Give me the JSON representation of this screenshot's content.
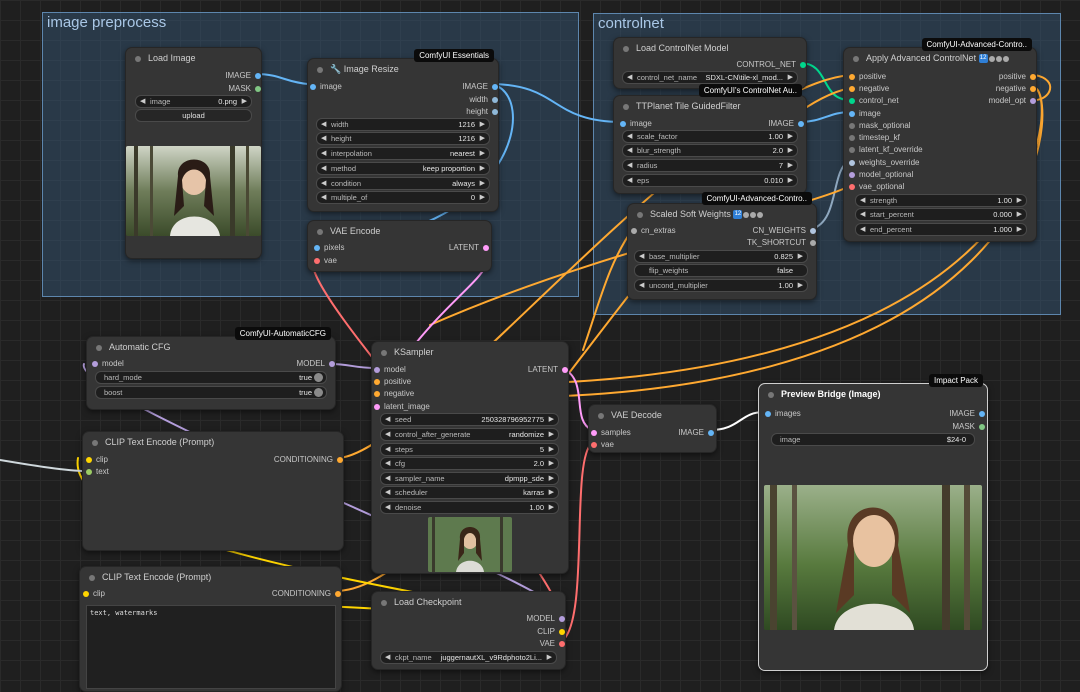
{
  "groups": {
    "image_preprocess": "image preprocess",
    "controlnet": "controlnet"
  },
  "badges": {
    "essentials": "ComfyUI Essentials",
    "advanced_controlnet": "ComfyUI-Advanced-Contro..",
    "controlnet_aux": "ComfyUI's ControlNet Au..",
    "advanced_controlnet_2": "ComfyUI-Advanced-Contro..",
    "automatic_cfg": "ComfyUI-AutomaticCFG",
    "impact_pack": "Impact Pack"
  },
  "load_image": {
    "title": "Load Image",
    "out_image": "IMAGE",
    "out_mask": "MASK",
    "image_label": "image",
    "image_value": "0.png",
    "upload": "upload"
  },
  "image_resize": {
    "title": "Image Resize",
    "in_image": "image",
    "out_image": "IMAGE",
    "out_width": "width",
    "out_height": "height",
    "widgets": [
      {
        "label": "width",
        "value": "1216"
      },
      {
        "label": "height",
        "value": "1216"
      },
      {
        "label": "interpolation",
        "value": "nearest"
      },
      {
        "label": "method",
        "value": "keep proportion"
      },
      {
        "label": "condition",
        "value": "always"
      },
      {
        "label": "multiple_of",
        "value": "0"
      }
    ]
  },
  "vae_encode": {
    "title": "VAE Encode",
    "in_pixels": "pixels",
    "in_vae": "vae",
    "out_latent": "LATENT"
  },
  "load_controlnet": {
    "title": "Load ControlNet Model",
    "out": "CONTROL_NET",
    "name_label": "control_net_name",
    "name_value": "SDXL-CN\\tile-xl_mod..."
  },
  "tile_filter": {
    "title": "TTPlanet Tile GuidedFilter",
    "in_image": "image",
    "out_image": "IMAGE",
    "widgets": [
      {
        "label": "scale_factor",
        "value": "1.00"
      },
      {
        "label": "blur_strength",
        "value": "2.0"
      },
      {
        "label": "radius",
        "value": "7"
      },
      {
        "label": "eps",
        "value": "0.010"
      }
    ]
  },
  "scaled_soft": {
    "title": "Scaled Soft Weights",
    "in_extras": "cn_extras",
    "out_cn": "CN_WEIGHTS",
    "out_tk": "TK_SHORTCUT",
    "widgets": [
      {
        "label": "base_multiplier",
        "value": "0.825"
      },
      {
        "label": "flip_weights",
        "value": "false"
      },
      {
        "label": "uncond_multiplier",
        "value": "1.00"
      }
    ]
  },
  "apply_cn": {
    "title": "Apply Advanced ControlNet",
    "inputs": [
      "positive",
      "negative",
      "control_net",
      "image",
      "mask_optional",
      "timestep_kf",
      "latent_kf_override",
      "weights_override",
      "model_optional",
      "vae_optional"
    ],
    "outputs": [
      "positive",
      "negative",
      "model_opt"
    ],
    "widgets": [
      {
        "label": "strength",
        "value": "1.00"
      },
      {
        "label": "start_percent",
        "value": "0.000"
      },
      {
        "label": "end_percent",
        "value": "1.000"
      }
    ]
  },
  "auto_cfg": {
    "title": "Automatic CFG",
    "in_model": "model",
    "out_model": "MODEL",
    "widgets": [
      {
        "label": "hard_mode",
        "value": "true"
      },
      {
        "label": "boost",
        "value": "true"
      }
    ]
  },
  "clip_pos": {
    "title": "CLIP Text Encode (Prompt)",
    "in_clip": "clip",
    "in_text": "text",
    "out": "CONDITIONING"
  },
  "clip_neg": {
    "title": "CLIP Text Encode (Prompt)",
    "in_clip": "clip",
    "out": "CONDITIONING",
    "text": "text, watermarks"
  },
  "ksampler": {
    "title": "KSampler",
    "inputs": [
      "model",
      "positive",
      "negative",
      "latent_image"
    ],
    "out": "LATENT",
    "widgets": [
      {
        "label": "seed",
        "value": "250328796952775"
      },
      {
        "label": "control_after_generate",
        "value": "randomize"
      },
      {
        "label": "steps",
        "value": "5"
      },
      {
        "label": "cfg",
        "value": "2.0"
      },
      {
        "label": "sampler_name",
        "value": "dpmpp_sde"
      },
      {
        "label": "scheduler",
        "value": "karras"
      },
      {
        "label": "denoise",
        "value": "1.00"
      }
    ]
  },
  "vae_decode": {
    "title": "VAE Decode",
    "in_samples": "samples",
    "in_vae": "vae",
    "out": "IMAGE"
  },
  "preview": {
    "title": "Preview Bridge (Image)",
    "in_images": "images",
    "out_image": "IMAGE",
    "out_mask": "MASK",
    "image_label": "image",
    "image_value": "$24-0"
  },
  "checkpoint": {
    "title": "Load Checkpoint",
    "out_model": "MODEL",
    "out_clip": "CLIP",
    "out_vae": "VAE",
    "ckpt_label": "ckpt_name",
    "ckpt_value": "juggernautXL_v9Rdphoto2Li..."
  },
  "colors": {
    "image": "#64b5f6",
    "latent": "#ff9cf9",
    "vae": "#ff6e6e",
    "model": "#b39ddb",
    "clip": "#ffd500",
    "conditioning": "#ffa931",
    "controlnet": "#00d78d",
    "mask": "#81c784"
  }
}
